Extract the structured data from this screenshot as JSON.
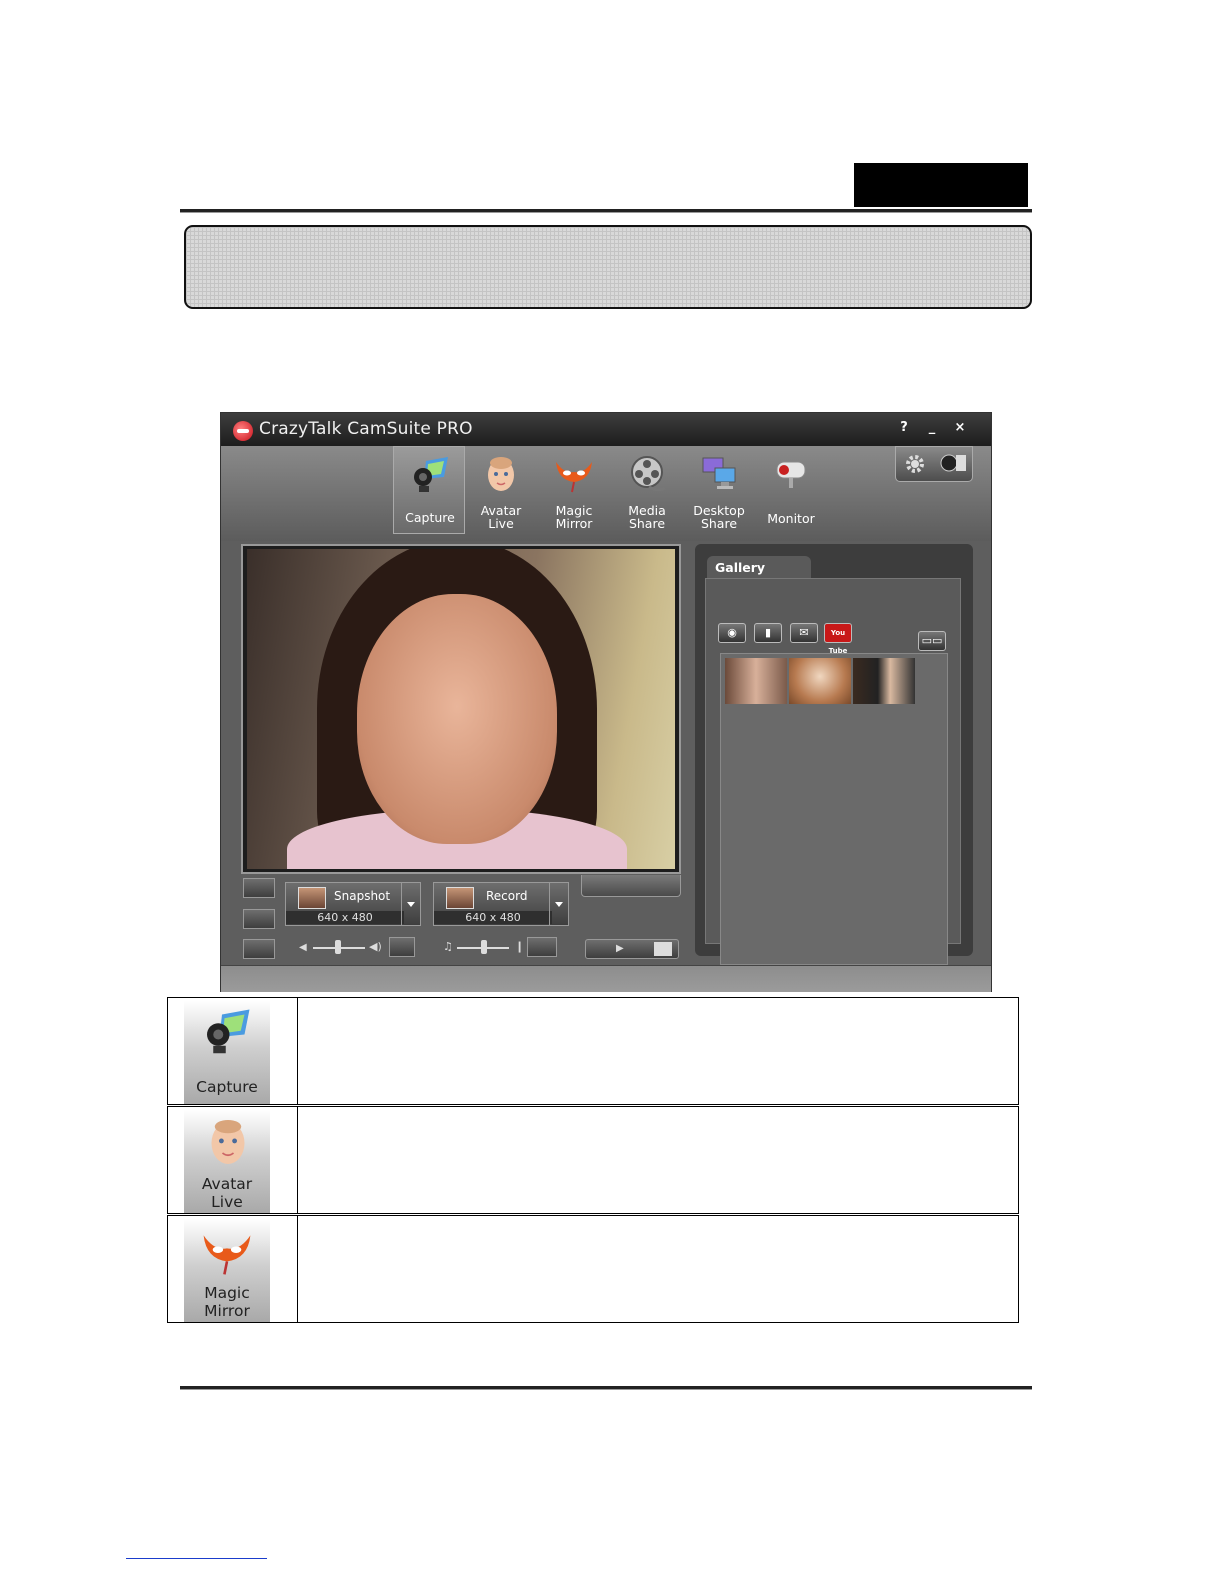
{
  "app": {
    "title": "CrazyTalk CamSuite PRO",
    "window_buttons": [
      "?",
      "_",
      "×"
    ]
  },
  "modes": [
    {
      "label": "Capture",
      "icon": "webcam-icon",
      "active": true
    },
    {
      "label": "Avatar\nLive",
      "icon": "baby-face-icon",
      "active": false
    },
    {
      "label": "Magic\nMirror",
      "icon": "mask-icon",
      "active": false
    },
    {
      "label": "Media\nShare",
      "icon": "film-reel-icon",
      "active": false
    },
    {
      "label": "Desktop\nShare",
      "icon": "monitors-icon",
      "active": false
    },
    {
      "label": "Monitor",
      "icon": "security-camera-icon",
      "active": false
    }
  ],
  "controls": {
    "snapshot_label": "Snapshot",
    "snapshot_res": "640 x 480",
    "record_label": "Record",
    "record_res": "640 x 480"
  },
  "gallery": {
    "title": "Gallery",
    "youtube_label": "You Tube"
  },
  "feature_table": [
    {
      "label_1": "Capture",
      "label_2": ""
    },
    {
      "label_1": "Avatar",
      "label_2": "Live"
    },
    {
      "label_1": "Magic",
      "label_2": "Mirror"
    }
  ],
  "colors": {
    "window_bg": "#5e5e5e",
    "title_bar": "#2a2a2a",
    "accent_red": "#c8101a"
  }
}
